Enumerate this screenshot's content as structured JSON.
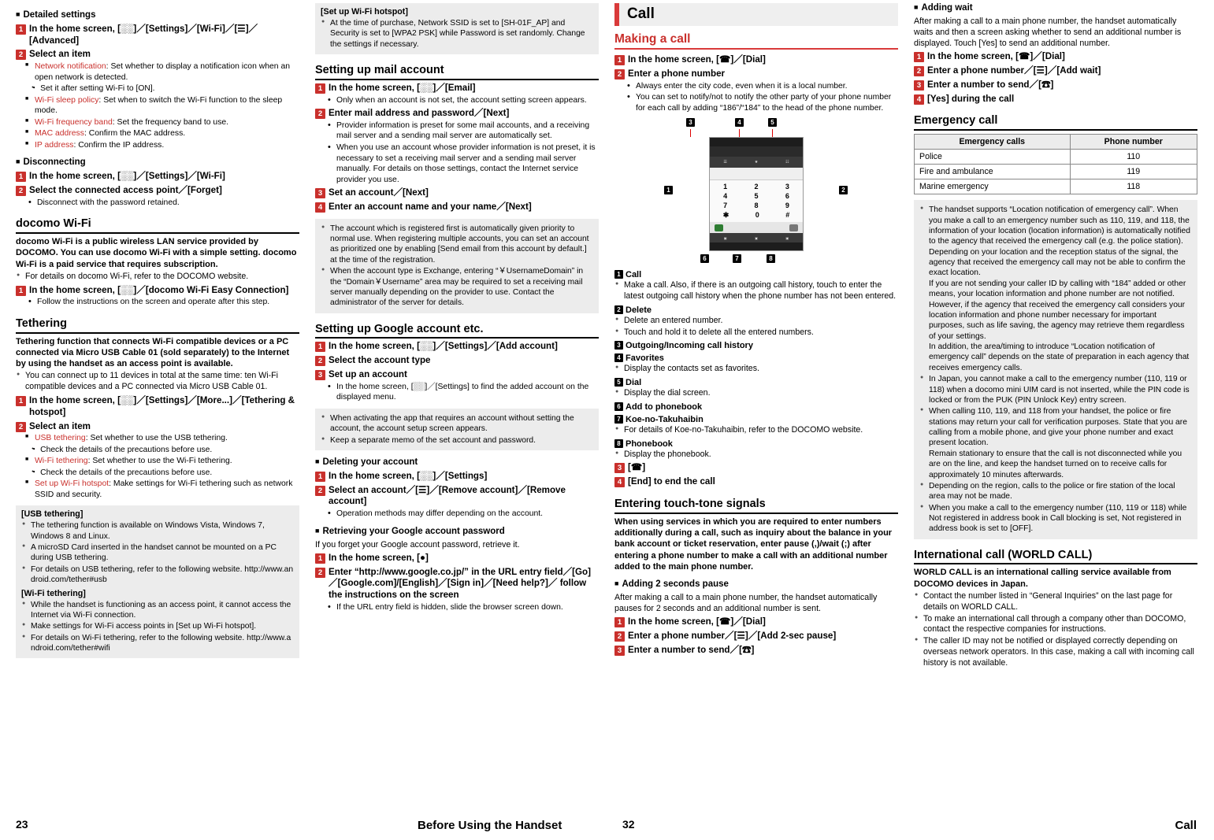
{
  "page_left": "23",
  "page_right": "32",
  "footer_center": "Before Using the Handset",
  "footer_right": "Call",
  "col1": {
    "h_detailed": "Detailed settings",
    "s1": "In the home screen, [░░]／[Settings]／[Wi-Fi]／[☰]／[Advanced]",
    "s2": "Select an item",
    "items": [
      {
        "label": "Network notification",
        "text": ": Set whether to display a notification icon when an open network is detected."
      },
      {
        "label": "Wi-Fi sleep policy",
        "text": ": Set when to switch the Wi-Fi function to the sleep mode."
      },
      {
        "label": "Wi-Fi frequency band",
        "text": ": Set the frequency band to use."
      },
      {
        "label": "MAC address",
        "text": ": Confirm the MAC address."
      },
      {
        "label": "IP address",
        "text": ": Confirm the IP address."
      }
    ],
    "mid1": "・ Set it after setting Wi-Fi to [ON].",
    "h_disconnect": "Disconnecting",
    "d1": "In the home screen, [░░]／[Settings]／[Wi-Fi]",
    "d2": "Select the connected access point／[Forget]",
    "d2sub": "Disconnect with the password retained.",
    "h_docomo": "docomo Wi-Fi",
    "docomo_p1": "docomo Wi-Fi is a public wireless LAN service provided by DOCOMO. You can use docomo Wi-Fi with a simple setting. docomo Wi-Fi is a paid service that requires subscription.",
    "docomo_b1": "For details on docomo Wi-Fi, refer to the DOCOMO website.",
    "docomo_s1": "In the home screen, [░░]／[docomo Wi-Fi Easy Connection]",
    "docomo_s1sub": "Follow the instructions on the screen and operate after this step.",
    "h_tether": "Tethering",
    "tether_p": "Tethering function that connects Wi-Fi compatible devices or a PC connected via Micro USB Cable 01 (sold separately) to the Internet by using the handset as an access point is available.",
    "tether_b1": "You can connect up to 11 devices in total at the same time: ten Wi-Fi compatible devices and a PC connected via Micro USB Cable 01.",
    "t1": "In the home screen, [░░]／[Settings]／[More...]／[Tethering & hotspot]",
    "t2": "Select an item",
    "t_items": [
      {
        "label": "USB tethering",
        "text": ": Set whether to use the USB tethering."
      },
      {
        "label": "Wi-Fi tethering",
        "text": ": Set whether to use the Wi-Fi tethering."
      },
      {
        "label": "Set up Wi-Fi hotspot",
        "text": ": Make settings for Wi-Fi tethering such as network SSID and security."
      }
    ],
    "t_mid1": "・ Check the details of the precautions before use.",
    "t_mid2": "・ Check the details of the precautions before use.",
    "note_usb_hd": "[USB tethering]",
    "note_usb": [
      "The tethering function is available on Windows Vista, Windows 7, Windows 8 and Linux.",
      "A microSD Card inserted in the handset cannot be mounted on a PC during USB tethering.",
      "For details on USB tethering, refer to the following website. http://www.android.com/tether#usb"
    ],
    "note_wifi_hd": "[Wi-Fi tethering]",
    "note_wifi": [
      "While the handset is functioning as an access point, it cannot access the Internet via Wi-Fi connection.",
      "Make settings for Wi-Fi access points in [Set up Wi-Fi hotspot].",
      "For details on Wi-Fi tethering, refer to the following website. http://www.android.com/tether#wifi"
    ]
  },
  "col2": {
    "note_hotspot_hd": "[Set up Wi-Fi hotspot]",
    "note_hotspot": "At the time of purchase, Network SSID is set to [SH-01F_AP] and Security is set to [WPA2 PSK] while Password is set randomly. Change the settings if necessary.",
    "h_mail": "Setting up mail account",
    "m1": "In the home screen, [░░]／[Email]",
    "m1sub": "Only when an account is not set, the account setting screen appears.",
    "m2": "Enter mail address and password／[Next]",
    "m2sub1": "Provider information is preset for some mail accounts, and a receiving mail server and a sending mail server are automatically set.",
    "m2sub2": "When you use an account whose provider information is not preset, it is necessary to set a receiving mail server and a sending mail server manually. For details on those settings, contact the Internet service provider you use.",
    "m3": "Set an account／[Next]",
    "m4": "Enter an account name and your name／[Next]",
    "note_mail": [
      "The account which is registered first is automatically given priority to normal use. When registering multiple accounts, you can set an account as prioritized one by enabling [Send email from this account by default.] at the time of the registration.",
      "When the account type is Exchange, entering “￥UsernameDomain” in the “Domain￥Username” area may be required to set a receiving mail server manually depending on the provider to use. Contact the administrator of the server for details."
    ],
    "h_google": "Setting up Google account etc.",
    "g1": "In the home screen, [░░]／[Settings]／[Add account]",
    "g2": "Select the account type",
    "g3": "Set up an account",
    "g3sub": "In the home screen, [░░]／[Settings] to find the added account on the displayed menu.",
    "note_google": [
      "When activating the app that requires an account without setting the account, the account setup screen appears.",
      "Keep a separate memo of the set account and password."
    ],
    "h_delacct": "Deleting your account",
    "da1": "In the home screen, [░░]／[Settings]",
    "da2": "Select an account／[☰]／[Remove account]／[Remove account]",
    "da2sub": "Operation methods may differ depending on the account.",
    "h_retrieve": "Retrieving your Google account password",
    "retrieve_p": "If you forget your Google account password, retrieve it.",
    "r1": "In the home screen, [●]",
    "r2": "Enter “http://www.google.co.jp/” in the URL entry field／[Go]／[Google.com]/[English]／[Sign in]／[Need help?]／ follow the instructions on the screen",
    "r2sub": "If the URL entry field is hidden, slide the browser screen down."
  },
  "col3": {
    "bigtitle": "Call",
    "subtitle": "Making a call",
    "c1": "In the home screen, [☎]／[Dial]",
    "c2": "Enter a phone number",
    "c2sub1": "Always enter the city code, even when it is a local number.",
    "c2sub2": "You can set to notify/not to notify the other party of your phone number for each call by adding “186”/“184” to the head of the phone number.",
    "diagram_labels": [
      "1",
      "2",
      "3",
      "4",
      "5",
      "6",
      "7",
      "8"
    ],
    "keypad": [
      [
        "1",
        "2",
        "3"
      ],
      [
        "4",
        "5",
        "6"
      ],
      [
        "7",
        "8",
        "9"
      ],
      [
        "∗",
        "0",
        "#"
      ]
    ],
    "legend": [
      {
        "n": "1",
        "title": "Call",
        "bullets": [
          "Make a call. Also, if there is an outgoing call history, touch to enter the latest outgoing call history when the phone number has not been entered."
        ]
      },
      {
        "n": "2",
        "title": "Delete",
        "bullets": [
          "Delete an entered number.",
          "Touch and hold it to delete all the entered numbers."
        ]
      },
      {
        "n": "3",
        "title": "Outgoing/Incoming call history",
        "bullets": []
      },
      {
        "n": "4",
        "title": "Favorites",
        "bullets": [
          "Display the contacts set as favorites."
        ]
      },
      {
        "n": "5",
        "title": "Dial",
        "bullets": [
          "Display the dial screen."
        ]
      },
      {
        "n": "6",
        "title": "Add to phonebook",
        "bullets": []
      },
      {
        "n": "7",
        "title": "Koe-no-Takuhaibin",
        "bullets": [
          "For details of Koe-no-Takuhaibin, refer to the DOCOMO website."
        ]
      },
      {
        "n": "8",
        "title": "Phonebook",
        "bullets": [
          "Display the phonebook."
        ]
      }
    ],
    "c3": "[☎]",
    "c4": "[End] to end the call",
    "h_touchtone": "Entering touch-tone signals",
    "touchtone_p": "When using services in which you are required to enter numbers additionally during a call, such as inquiry about the balance in your bank account or ticket reservation, enter pause (,)/wait (;) after entering a phone number to make a call with an additional number added to the main phone number.",
    "h_pause": "Adding 2 seconds pause",
    "pause_p": "After making a call to a main phone number, the handset automatically pauses for 2 seconds and an additional number is sent.",
    "p1": "In the home screen, [☎]／[Dial]",
    "p2": "Enter a phone number／[☰]／[Add 2-sec pause]",
    "p3": "Enter a number to send／[☎]"
  },
  "col4": {
    "h_wait": "Adding wait",
    "wait_p": "After making a call to a main phone number, the handset automatically waits and then a screen asking whether to send an additional number is displayed. Touch [Yes] to send an additional number.",
    "w1": "In the home screen, [☎]／[Dial]",
    "w2": "Enter a phone number／[☰]／[Add wait]",
    "w3": "Enter a number to send／[☎]",
    "w4": "[Yes] during the call",
    "h_emergency": "Emergency call",
    "table": {
      "headers": [
        "Emergency calls",
        "Phone number"
      ],
      "rows": [
        [
          "Police",
          "110"
        ],
        [
          "Fire and ambulance",
          "119"
        ],
        [
          "Marine emergency",
          "118"
        ]
      ]
    },
    "note_emergency": [
      "The handset supports “Location notification of emergency call”. When you make a call to an emergency number such as 110, 119, and 118, the information of your location (location information) is automatically notified to the agency that received the emergency call (e.g. the police station). Depending on your location and the reception status of the signal, the agency that received the emergency call may not be able to confirm the exact location.\nIf you are not sending your caller ID by calling with “184” added or other means, your location information and phone number are not notified. However, if the agency that received the emergency call considers your location information and phone number necessary for important purposes, such as life saving, the agency may retrieve them regardless of your settings.\nIn addition, the area/timing to introduce “Location notification of emergency call” depends on the state of preparation in each agency that receives emergency calls.",
      "In Japan, you cannot make a call to the emergency number (110, 119 or 118) when a docomo mini UIM card is not inserted, while the PIN code is locked or from the PUK (PIN Unlock Key) entry screen.",
      "When calling 110, 119, and 118 from your handset, the police or fire stations may return your call for verification purposes. State that you are calling from a mobile phone, and give your phone number and exact present location.\nRemain stationary to ensure that the call is not disconnected while you are on the line, and keep the handset turned on to receive calls for approximately 10 minutes afterwards.",
      "Depending on the region, calls to the police or fire station of the local area may not be made.",
      "When you make a call to the emergency number (110, 119 or 118) while Not registered in address book in Call blocking is set, Not registered in address book is set to [OFF]."
    ],
    "h_world": "International call (WORLD CALL)",
    "world_p": "WORLD CALL is an international calling service available from DOCOMO devices in Japan.",
    "world_b": [
      "Contact the number listed in “General Inquiries” on the last page for details on WORLD CALL.",
      "To make an international call through a company other than DOCOMO, contact the respective companies for instructions.",
      "The caller ID may not be notified or displayed correctly depending on overseas network operators. In this case, making a call with incoming call history is not available."
    ]
  }
}
